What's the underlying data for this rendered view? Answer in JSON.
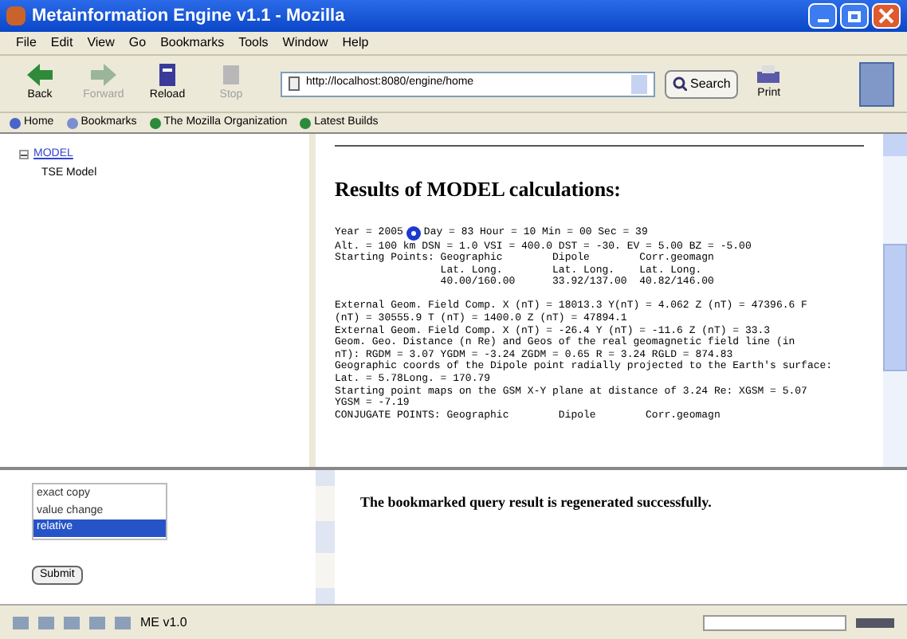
{
  "window": {
    "title": "Metainformation Engine v1.1 - Mozilla"
  },
  "menu": [
    "File",
    "Edit",
    "View",
    "Go",
    "Bookmarks",
    "Tools",
    "Window",
    "Help"
  ],
  "toolbar": {
    "buttons": [
      {
        "label": "Back",
        "kind": "back",
        "disabled": false
      },
      {
        "label": "Forward",
        "kind": "forward",
        "disabled": true
      },
      {
        "label": "Reload",
        "kind": "reload",
        "disabled": false
      },
      {
        "label": "Stop",
        "kind": "stop",
        "disabled": true
      }
    ],
    "url": "http://localhost:8080/engine/home",
    "search": "Search",
    "print": "Print"
  },
  "personal_toolbar": [
    "Home",
    "Bookmarks",
    "The Mozilla Organization",
    "Latest Builds"
  ],
  "tree": {
    "label": "MODEL",
    "expanded": true,
    "children": [
      {
        "label": "TSE Model"
      }
    ]
  },
  "results": {
    "heading": "Results of MODEL calculations:",
    "time_line": {
      "before": "Year = 2005",
      "after": "Day = 83 Hour = 10 Min = 00 Sec = 39"
    },
    "lines": [
      "Alt. = 100 km DSN = 1.0 VSI = 400.0 DST = -30. EV = 5.00 BZ = -5.00",
      "Starting Points: Geographic        Dipole        Corr.geomagn",
      "                 Lat. Long.        Lat. Long.    Lat. Long.",
      "                 40.00/160.00      33.92/137.00  40.82/146.00"
    ],
    "field_lines": [
      "External Geom. Field Comp. X (nT) = 18013.3 Y(nT) = 4.062 Z (nT) = 47396.6 F",
      "(nT) = 30555.9 T (nT) = 1400.0 Z (nT) = 47894.1",
      "External Geom. Field Comp. X (nT) = -26.4 Y (nT) = -11.6 Z (nT) = 33.3",
      "Geom. Geo. Distance (n Re) and Geos of the real geomagnetic field line (in",
      "nT): RGDM = 3.07 YGDM = -3.24 ZGDM = 0.65 R = 3.24 RGLD = 874.83",
      "Geographic coords of the Dipole point radially projected to the Earth's surface:",
      "Lat. = 5.78Long. = 170.79",
      "Starting point maps on the GSM X-Y plane at distance of 3.24 Re: XGSM = 5.07",
      "YGSM = -7.19",
      "CONJUGATE POINTS: Geographic        Dipole        Corr.geomagn"
    ]
  },
  "options": [
    {
      "label": "exact copy",
      "selected": false
    },
    {
      "label": "value change",
      "selected": false
    },
    {
      "label": "relative",
      "selected": true
    }
  ],
  "submit": "Submit",
  "message": "The bookmarked query result is regenerated successfully.",
  "status_bar": {
    "text": "ME v1.0"
  }
}
